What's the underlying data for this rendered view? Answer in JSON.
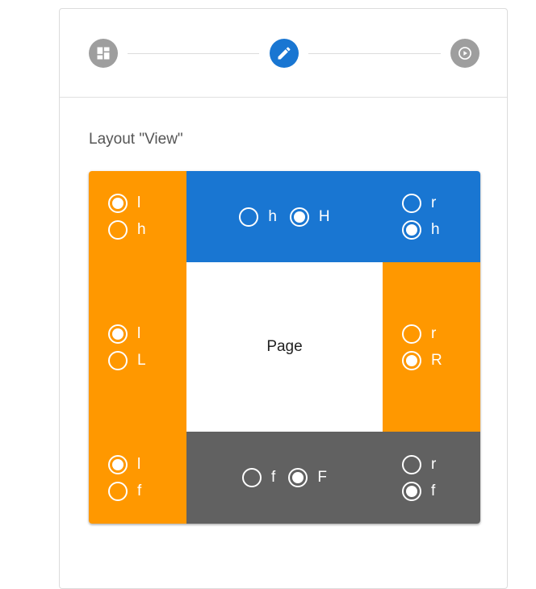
{
  "colors": {
    "primary": "#1976d2",
    "orange": "#ff9800",
    "gray_step": "#9e9e9e",
    "footer": "#616161",
    "page": "#ffffff"
  },
  "stepper": {
    "steps": [
      {
        "icon": "dashboard-icon",
        "state": "inactive"
      },
      {
        "icon": "edit-icon",
        "state": "active"
      },
      {
        "icon": "play-circle-icon",
        "state": "inactive"
      }
    ]
  },
  "section": {
    "title": "Layout \"View\""
  },
  "layout": {
    "left_top": {
      "options": [
        {
          "label": "l",
          "selected": true
        },
        {
          "label": "h",
          "selected": false
        }
      ]
    },
    "header": {
      "options": [
        {
          "label": "h",
          "selected": false
        },
        {
          "label": "H",
          "selected": true
        }
      ]
    },
    "right_top": {
      "options": [
        {
          "label": "r",
          "selected": false
        },
        {
          "label": "h",
          "selected": true
        }
      ]
    },
    "left_mid": {
      "options": [
        {
          "label": "l",
          "selected": true
        },
        {
          "label": "L",
          "selected": false
        }
      ]
    },
    "page": {
      "label": "Page"
    },
    "right_mid": {
      "options": [
        {
          "label": "r",
          "selected": false
        },
        {
          "label": "R",
          "selected": true
        }
      ]
    },
    "left_bottom": {
      "options": [
        {
          "label": "l",
          "selected": true
        },
        {
          "label": "f",
          "selected": false
        }
      ]
    },
    "footer": {
      "options": [
        {
          "label": "f",
          "selected": false
        },
        {
          "label": "F",
          "selected": true
        }
      ]
    },
    "right_bottom": {
      "options": [
        {
          "label": "r",
          "selected": false
        },
        {
          "label": "f",
          "selected": true
        }
      ]
    }
  }
}
